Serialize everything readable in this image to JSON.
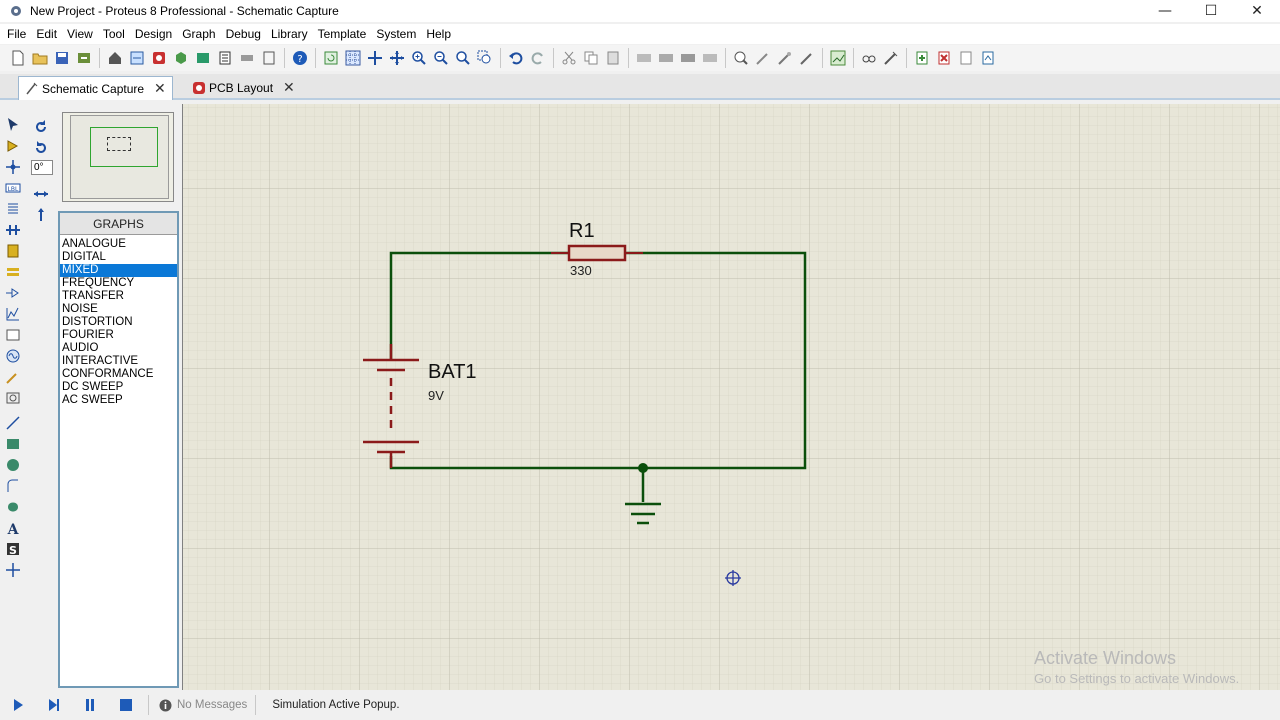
{
  "window": {
    "title": "New Project - Proteus 8 Professional - Schematic Capture",
    "minimize": "—",
    "maximize": "☐",
    "close": "✕"
  },
  "menu": [
    "File",
    "Edit",
    "View",
    "Tool",
    "Design",
    "Graph",
    "Debug",
    "Library",
    "Template",
    "System",
    "Help"
  ],
  "tabs": [
    {
      "label": "Schematic Capture",
      "icon": "schematic-icon",
      "active": true
    },
    {
      "label": "PCB Layout",
      "icon": "pcb-icon",
      "active": false
    }
  ],
  "tab_close": "✕",
  "left_panel": {
    "rotation_angle": "0°",
    "graphs_header": "GRAPHS",
    "graph_types": [
      "ANALOGUE",
      "DIGITAL",
      "MIXED",
      "FREQUENCY",
      "TRANSFER",
      "NOISE",
      "DISTORTION",
      "FOURIER",
      "AUDIO",
      "INTERACTIVE",
      "CONFORMANCE",
      "DC SWEEP",
      "AC SWEEP"
    ],
    "selected_graph": "MIXED"
  },
  "schematic": {
    "resistor": {
      "ref": "R1",
      "value": "330"
    },
    "battery": {
      "ref": "BAT1",
      "value": "9V"
    },
    "wire_color": "#0b4f0b",
    "component_color": "#8b1a1a"
  },
  "status": {
    "message": "No Messages",
    "popup": "Simulation Active Popup."
  },
  "watermark": {
    "line1": "Activate Windows",
    "line2": "Go to Settings to activate Windows."
  },
  "colors": {
    "selection": "#0a78d7",
    "grid_bg": "#e8e6d8",
    "panel_border": "#6f99b5"
  }
}
